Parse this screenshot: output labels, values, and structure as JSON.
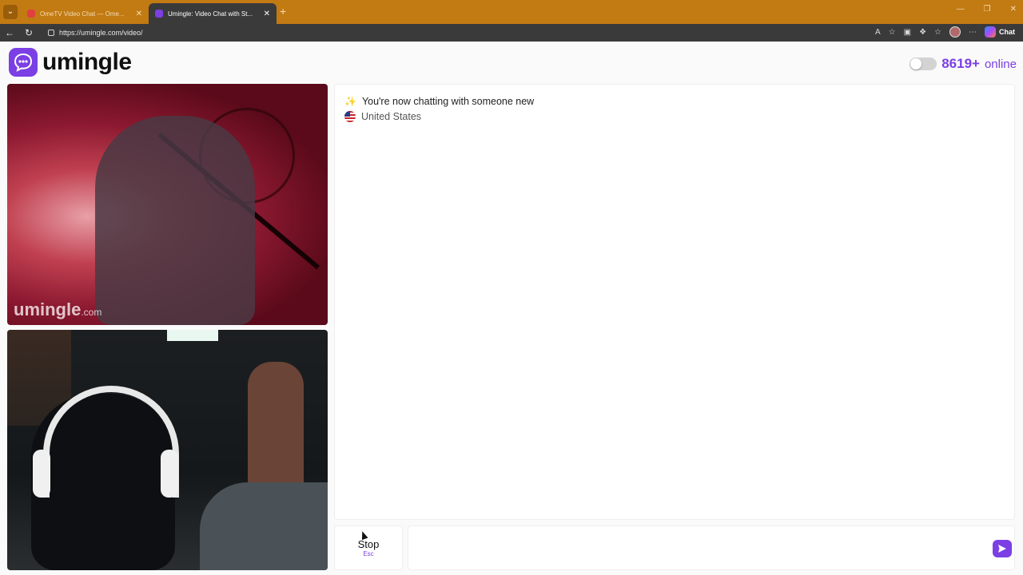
{
  "browser": {
    "tabs": [
      {
        "label": "OmeTV Video Chat — Ome...",
        "active": false
      },
      {
        "label": "Umingle: Video Chat with St...",
        "active": true
      }
    ],
    "new_tab": "+",
    "url": "https://umingle.com/video/",
    "copilot_label": "Chat",
    "window_controls": [
      "—",
      "❐",
      "✕"
    ]
  },
  "header": {
    "logo_text": "umingle",
    "online_count": "8619+",
    "online_label": "online"
  },
  "stranger_video": {
    "watermark": "umingle",
    "watermark_suffix": ".com"
  },
  "chat": {
    "status_message": "You're now chatting with someone new",
    "country": "United States"
  },
  "controls": {
    "stop_label": "Stop",
    "stop_key": "Esc",
    "message_placeholder": ""
  },
  "colors": {
    "accent": "#7b3fe4",
    "tab_bar": "#c27a12",
    "toolbar": "#3a3a3a"
  },
  "icons": [
    "back-icon",
    "refresh-icon",
    "lock-icon",
    "read-aloud-icon",
    "favorite-icon",
    "extensions-icon",
    "collections-icon",
    "more-icon",
    "send-icon",
    "chat-bubble-icon"
  ]
}
